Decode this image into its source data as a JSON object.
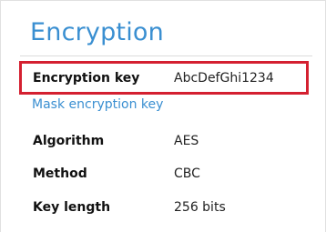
{
  "section": {
    "title": "Encryption"
  },
  "encryption_key": {
    "label": "Encryption key",
    "value": "AbcDefGhi1234",
    "mask_link": "Mask encryption key"
  },
  "details": [
    {
      "label": "Algorithm",
      "value": "AES"
    },
    {
      "label": "Method",
      "value": "CBC"
    },
    {
      "label": "Key length",
      "value": "256 bits"
    }
  ],
  "colors": {
    "title_accent": "#3a8fd1",
    "link": "#3a8fd1",
    "highlight_border": "#d42030"
  }
}
